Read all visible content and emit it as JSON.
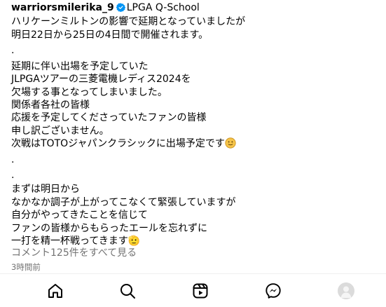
{
  "post": {
    "username": "warriorsmilerika_9",
    "location": "LPGA Q-School",
    "caption_lines": [
      "ハリケーンミルトンの影響で延期となっていましたが",
      "明日22日から25日の4日間で開催されます。",
      ".",
      "延期に伴い出場を予定していた",
      "JLPGAツアーの三菱電機レディス2024を",
      "欠場する事となってしまいました。",
      "関係者各社の皆様",
      "応援を予定してくださっていたファンの皆様",
      "申し訳ございません。",
      "次戦はTOTOジャパンクラシックに出場予定です",
      ".",
      ".",
      "まずは明日から",
      "なかなか調子が上がってこなくて緊張していますが",
      "自分がやってきたことを信じて",
      "ファンの皆様からもらったエールを忘れずに",
      "一打を精一杯戦ってきます🫡"
    ],
    "view_comments": "コメント125件をすべて見る",
    "timestamp": "3時間前"
  },
  "nav": {
    "items": [
      {
        "name": "home-icon"
      },
      {
        "name": "search-icon"
      },
      {
        "name": "reels-icon"
      },
      {
        "name": "messenger-icon"
      },
      {
        "name": "profile-avatar"
      }
    ]
  },
  "colors": {
    "verified": "#0095f6",
    "secondary_text": "#737373",
    "emoji": "#f5c44a"
  }
}
